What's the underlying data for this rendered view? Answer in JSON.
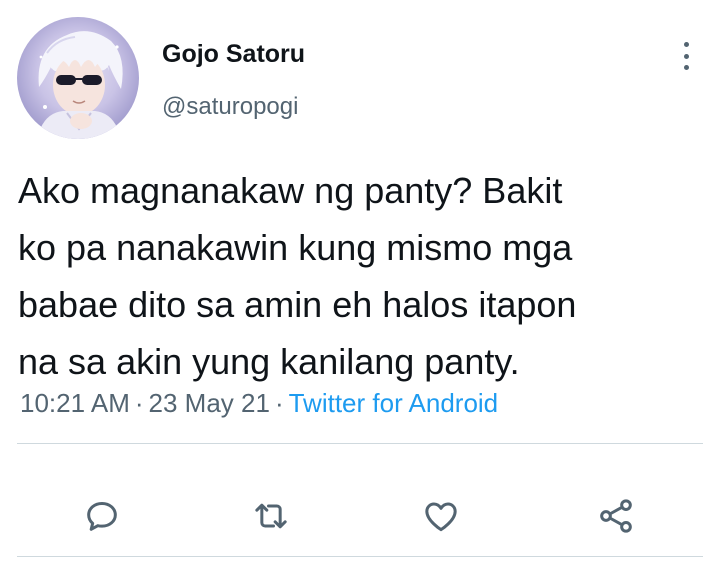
{
  "tweet": {
    "author": {
      "display_name": "Gojo Satoru",
      "handle": "@saturopogi"
    },
    "text": "Ako magnanakaw ng panty? Bakit\nko pa nanakawin kung mismo mga\nbabae dito sa amin eh halos itapon\nna sa akin yung kanilang panty.",
    "time": "10:21 AM",
    "date": "23 May 21",
    "source": "Twitter for Android",
    "separator": "·"
  },
  "actions": {
    "reply_icon": "reply-icon",
    "retweet_icon": "retweet-icon",
    "like_icon": "heart-icon",
    "share_icon": "share-icon"
  },
  "colors": {
    "primary_text": "#0f1419",
    "secondary_text": "#536471",
    "link": "#1d9bf0",
    "divider": "#cfd9de"
  }
}
